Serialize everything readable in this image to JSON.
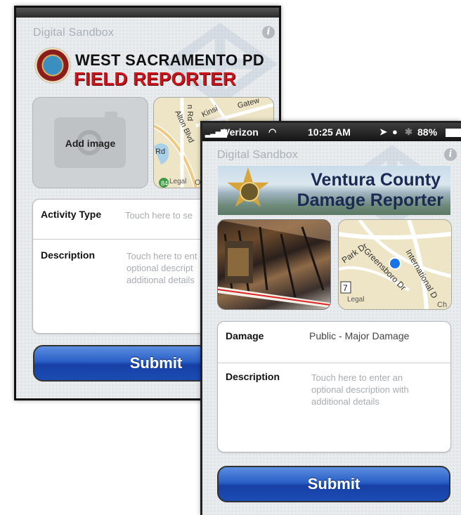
{
  "phone1": {
    "ds_logo": "Digital Sandbox",
    "title_line1": "WEST SACRAMENTO PD",
    "title_line2": "FIELD REPORTER",
    "seal_text": "THE CITY OF WEST SACRAMENTO",
    "add_image_label": "Add image",
    "map_labels": [
      "Kinsington Rd",
      "Alton Blvd",
      "Gatew",
      "Rd",
      "Legal",
      "O",
      "84"
    ],
    "activity_label": "Activity Type",
    "activity_placeholder": "Touch here to se",
    "description_label": "Description",
    "description_placeholder": [
      "Touch here to ent",
      "optional descript",
      "additional details"
    ],
    "submit_label": "Submit"
  },
  "phone2": {
    "status": {
      "carrier": "Verizon",
      "time": "10:25 AM",
      "battery": "88%"
    },
    "ds_logo": "Digital Sandbox",
    "banner_line1": "Ventura County",
    "banner_line2": "Damage Reporter",
    "map_labels": [
      "Park Dr",
      "Greensboro Dr",
      "International D",
      "Legal",
      "7",
      "Ch"
    ],
    "damage_label": "Damage",
    "damage_value": "Public - Major Damage",
    "description_label": "Description",
    "description_placeholder": [
      "Touch here to enter an",
      "optional description with",
      "additional details"
    ],
    "submit_label": "Submit"
  },
  "colors": {
    "accent_blue": "#2a5fc6",
    "title_red": "#c8141a",
    "placeholder_gray": "#a9acb0"
  }
}
